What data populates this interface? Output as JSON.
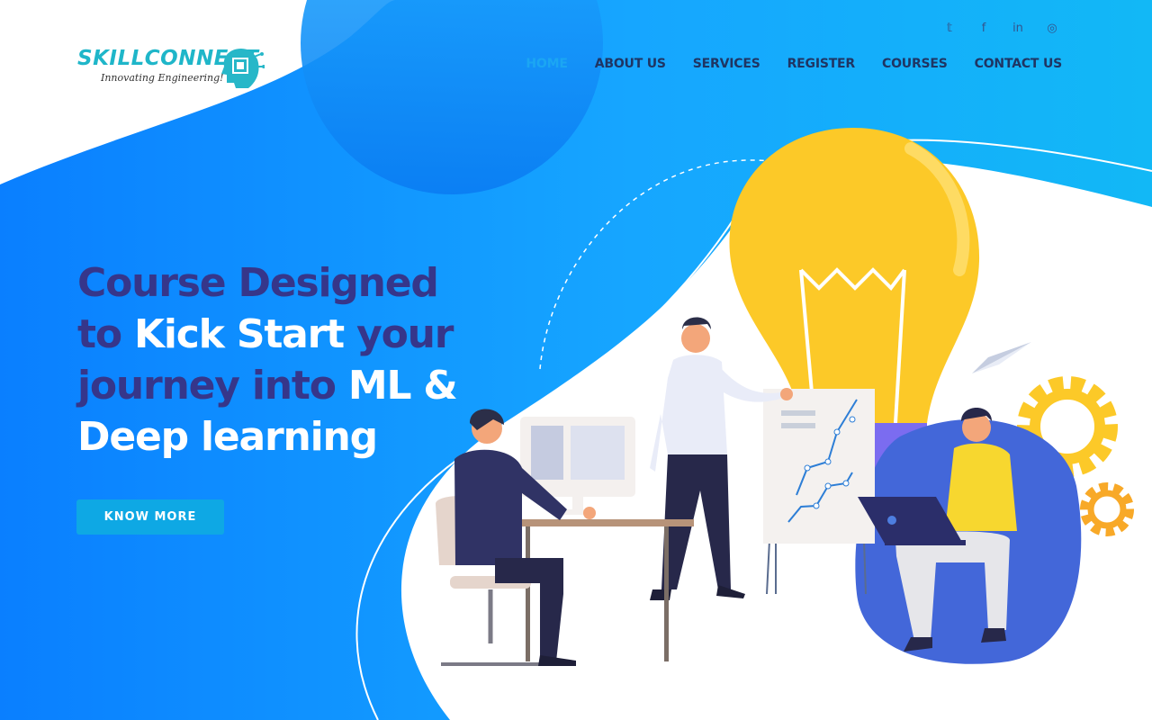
{
  "brand": {
    "name": "SKILLCONNECT",
    "tagline": "Innovating Engineering!"
  },
  "social": [
    {
      "icon": "twitter-icon",
      "glyph": "𝕥"
    },
    {
      "icon": "facebook-icon",
      "glyph": "f"
    },
    {
      "icon": "linkedin-icon",
      "glyph": "in"
    },
    {
      "icon": "instagram-icon",
      "glyph": "◎"
    }
  ],
  "nav": {
    "items": [
      {
        "label": "HOME",
        "active": true
      },
      {
        "label": "ABOUT US"
      },
      {
        "label": "SERVICES"
      },
      {
        "label": "REGISTER"
      },
      {
        "label": "COURSES"
      },
      {
        "label": "CONTACT US"
      }
    ]
  },
  "hero": {
    "line1_a": "Course Designed",
    "line2_a": "to ",
    "line2_b": "Kick Start",
    "line2_c": " your",
    "line3_a": "journey into ",
    "line3_b": "ML &",
    "line4_a": "Deep learning",
    "cta_label": "KNOW MORE"
  },
  "colors": {
    "primary_blue": "#0a84ff",
    "accent": "#1ba6f3",
    "title_dark": "#36368a",
    "cta": "#0ea8e4"
  }
}
